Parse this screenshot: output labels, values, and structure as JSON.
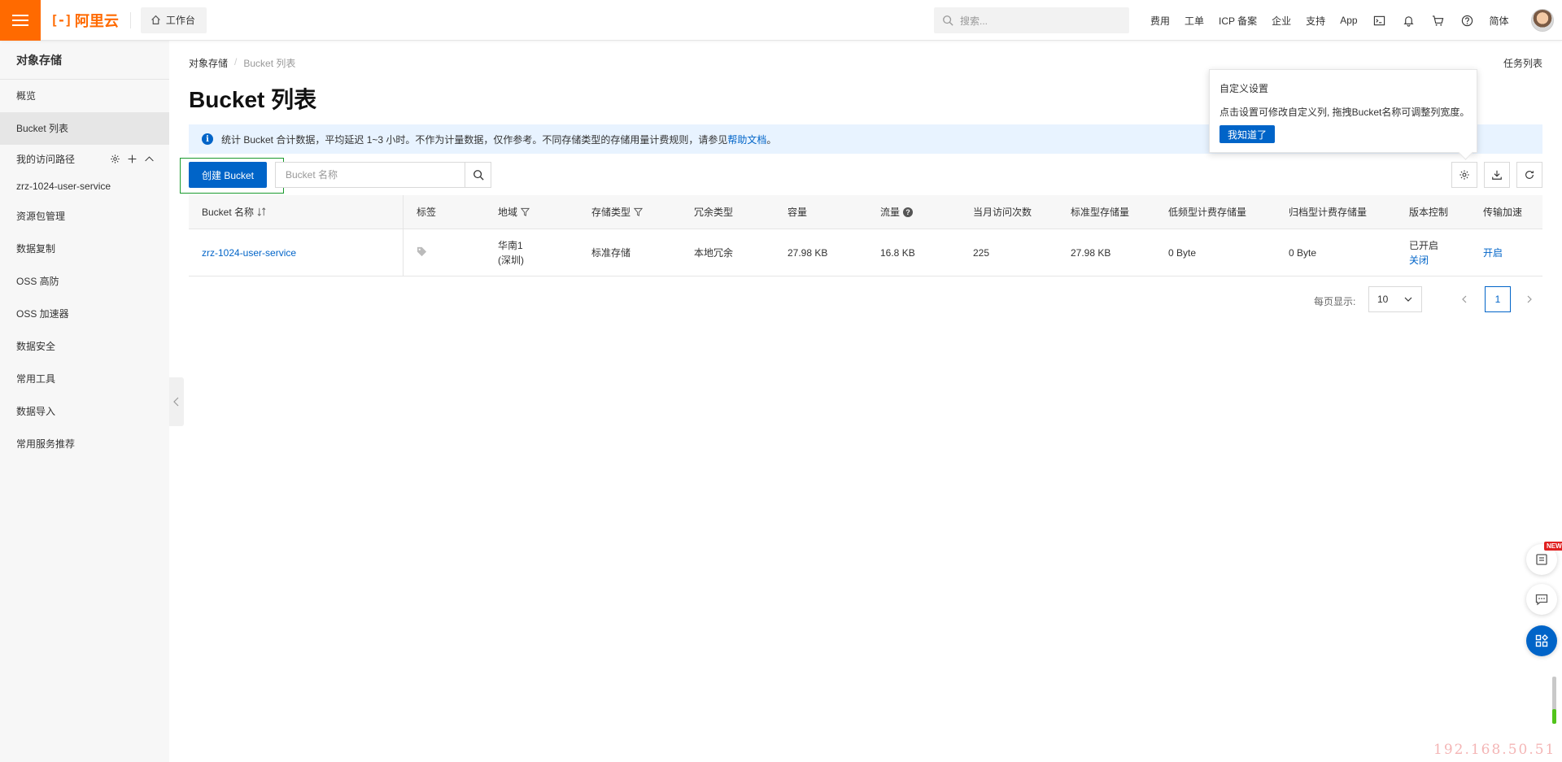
{
  "topbar": {
    "brand": "阿里云",
    "brand_mark": "[-]",
    "workbench_label": "工作台",
    "search_placeholder": "搜索...",
    "nav_links": [
      "费用",
      "工单",
      "ICP 备案",
      "企业",
      "支持",
      "App"
    ],
    "language": "简体",
    "accent_color": "#ff6a00"
  },
  "sidebar": {
    "title": "对象存储",
    "items_top": [
      {
        "label": "概览",
        "active": false
      },
      {
        "label": "Bucket 列表",
        "active": true
      }
    ],
    "group_label": "我的访问路径",
    "group_items": [
      "zrz-1024-user-service"
    ],
    "items_bottom": [
      "资源包管理",
      "数据复制",
      "OSS 高防",
      "OSS 加速器",
      "数据安全",
      "常用工具",
      "数据导入",
      "常用服务推荐"
    ]
  },
  "main": {
    "breadcrumb": [
      "对象存储",
      "Bucket 列表"
    ],
    "task_list": "任务列表",
    "page_title": "Bucket 列表",
    "banner_text": "统计 Bucket 合计数据，平均延迟 1~3 小时。不作为计量数据，仅作参考。不同存储类型的存储用量计费规则，请参见",
    "banner_link": "帮助文档",
    "banner_end": "。",
    "create_button": "创建 Bucket",
    "search_placeholder": "Bucket 名称",
    "primary_color": "#0064c8"
  },
  "table": {
    "headers": [
      "Bucket 名称",
      "标签",
      "地域",
      "存储类型",
      "冗余类型",
      "容量",
      "流量",
      "当月访问次数",
      "标准型存储量",
      "低频型计费存储量",
      "归档型计费存储量",
      "版本控制",
      "传输加速"
    ],
    "rows": [
      {
        "name": "zrz-1024-user-service",
        "region_line1": "华南1",
        "region_line2": "(深圳)",
        "storage_type": "标准存储",
        "redundancy": "本地冗余",
        "capacity": "27.98 KB",
        "traffic": "16.8 KB",
        "visits": "225",
        "standard_storage": "27.98 KB",
        "ia_storage": "0 Byte",
        "archive_storage": "0 Byte",
        "versioning_status": "已开启",
        "versioning_action": "关闭",
        "acceleration": "开启"
      }
    ]
  },
  "pagination": {
    "page_size_label": "每页显示:",
    "page_size": "10",
    "current_page": "1"
  },
  "popover": {
    "title": "自定义设置",
    "body": "点击设置可修改自定义列, 拖拽Bucket名称可调整列宽度。",
    "button": "我知道了"
  },
  "floating": {
    "new_badge": "NEW"
  },
  "watermark": "192.168.50.51"
}
